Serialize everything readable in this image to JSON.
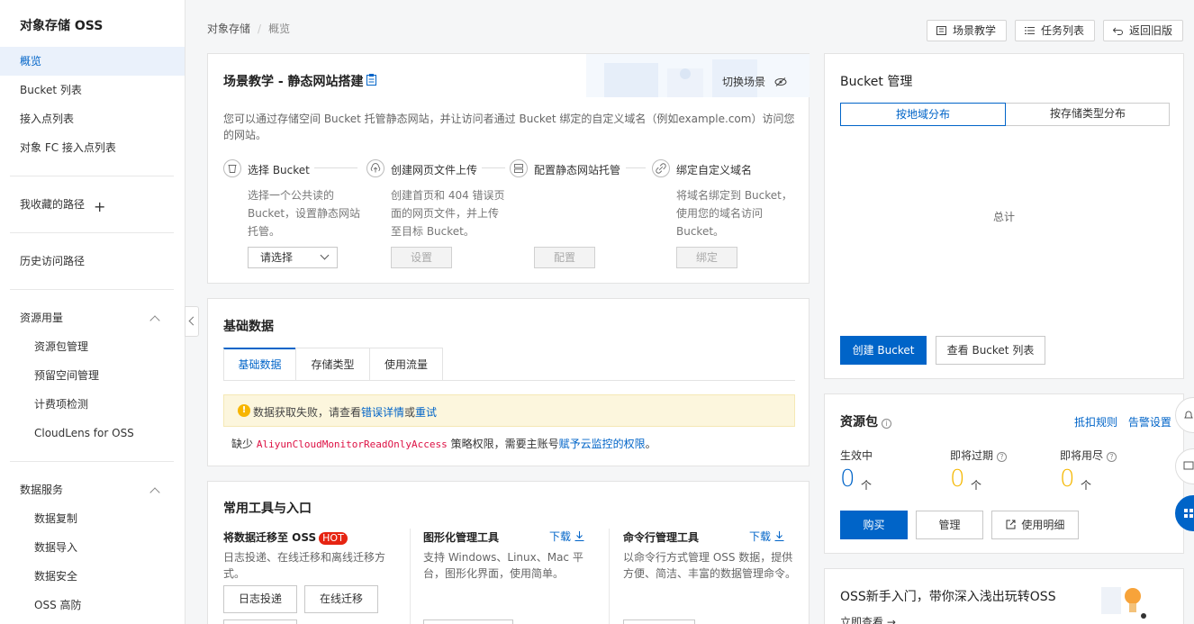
{
  "sidebar": {
    "title": "对象存储 OSS",
    "items": [
      "概览",
      "Bucket 列表",
      "接入点列表",
      "对象 FC 接入点列表"
    ],
    "favorites": "我收藏的路径",
    "history": "历史访问路径",
    "resource_group": "资源用量",
    "resource_items": [
      "资源包管理",
      "预留空间管理",
      "计费项检测",
      "CloudLens for OSS"
    ],
    "data_group": "数据服务",
    "data_items": [
      "数据复制",
      "数据导入",
      "数据安全",
      "OSS 高防"
    ]
  },
  "breadcrumb": {
    "root": "对象存储",
    "sep": "/",
    "current": "概览"
  },
  "header_buttons": {
    "tutorial": "场景教学",
    "tasks": "任务列表",
    "back": "返回旧版"
  },
  "scene": {
    "title": "场景教学 - 静态网站搭建",
    "switch": "切换场景",
    "desc": "您可以通过存储空间 Bucket 托管静态网站，并让访问者通过 Bucket 绑定的自定义域名（例如example.com）访问您的网站。",
    "steps": [
      {
        "label": "选择 Bucket",
        "desc": "选择一个公共读的 Bucket，设置静态网站托管。",
        "action": "请选择"
      },
      {
        "label": "创建网页文件上传",
        "desc": "创建首页和 404 错误页面的网页文件，并上传至目标 Bucket。",
        "action": "设置"
      },
      {
        "label": "配置静态网站托管",
        "desc": "",
        "action": "配置"
      },
      {
        "label": "绑定自定义域名",
        "desc": "将域名绑定到 Bucket，使用您的域名访问 Bucket。",
        "action": "绑定"
      }
    ]
  },
  "basic": {
    "title": "基础数据",
    "tabs": [
      "基础数据",
      "存储类型",
      "使用流量"
    ],
    "warn_prefix": "数据获取失败，请查看",
    "warn_link1": "错误详情",
    "warn_or": "或",
    "warn_link2": "重试",
    "perm_prefix": "缺少",
    "perm_code": "AliyunCloudMonitorReadOnlyAccess",
    "perm_mid": "策略权限，需要主账号",
    "perm_link": "赋予云监控的权限",
    "perm_end": "。"
  },
  "tools": {
    "title": "常用工具与入口",
    "migrate": {
      "title": "将数据迁移至 OSS",
      "hot": "HOT",
      "desc": "日志投递、在线迁移和离线迁移方式。",
      "btn1": "日志投递",
      "btn2": "在线迁移"
    },
    "gui": {
      "title": "图形化管理工具",
      "download": "下载",
      "desc": "支持 Windows、Linux、Mac 平台，图形化界面，使用简单。"
    },
    "cli": {
      "title": "命令行管理工具",
      "download": "下载",
      "desc": "以命令行方式管理 OSS 数据，提供方便、简洁、丰富的数据管理命令。"
    }
  },
  "bucket_mgmt": {
    "title": "Bucket 管理",
    "tabs": [
      "按地域分布",
      "按存储类型分布"
    ],
    "total": "总计",
    "create": "创建 Bucket",
    "view": "查看 Bucket 列表"
  },
  "resource_pack": {
    "title": "资源包",
    "link1": "抵扣规则",
    "link2": "告警设置",
    "stats": [
      {
        "label": "生效中",
        "value": "0",
        "unit": "个",
        "color": "#0064c8"
      },
      {
        "label": "即将过期",
        "value": "0",
        "unit": "个",
        "color": "#f5b700"
      },
      {
        "label": "即将用尽",
        "value": "0",
        "unit": "个",
        "color": "#f5b700"
      }
    ],
    "buy": "购买",
    "manage": "管理",
    "detail": "使用明细"
  },
  "newbie": {
    "title": "OSS新手入门，带你深入浅出玩转OSS",
    "link": "立即查看"
  }
}
